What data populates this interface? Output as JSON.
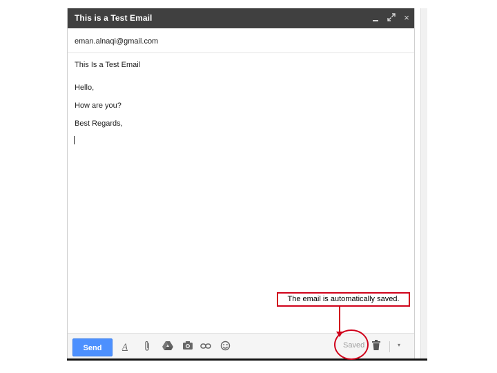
{
  "compose": {
    "title": "This is a Test Email",
    "to": "eman.alnaqi@gmail.com",
    "subject": "This Is a Test Email",
    "body_lines": [
      "Hello,",
      "How are you?",
      "Best Regards,"
    ]
  },
  "window_controls": {
    "minimize_icon": "minimize-icon",
    "popout_icon": "popout-icon",
    "close_glyph": "×"
  },
  "toolbar": {
    "send_label": "Send",
    "format_glyph": "A",
    "status": "Saved",
    "more_glyph": "▾",
    "icons": [
      "format-text-icon",
      "attach-icon",
      "drive-icon",
      "photo-icon",
      "link-icon",
      "emoji-icon",
      "trash-icon",
      "more-options-icon"
    ]
  },
  "annotation": {
    "callout_text": "The email is automatically saved.",
    "color": "#d0021b"
  },
  "colors": {
    "titlebar": "#404040",
    "send_button": "#4d90fe"
  }
}
